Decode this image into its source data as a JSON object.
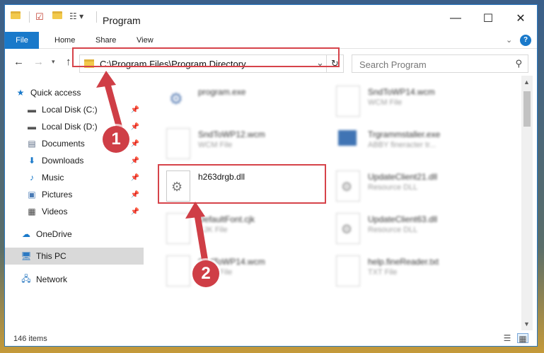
{
  "window": {
    "title": "Program"
  },
  "ribbon": {
    "tabs": [
      "File",
      "Home",
      "Share",
      "View"
    ]
  },
  "address": {
    "path": "C:\\Program Files\\Program Directory"
  },
  "search": {
    "placeholder": "Search Program"
  },
  "sidebar": {
    "items": [
      {
        "label": "Quick access"
      },
      {
        "label": "Local Disk (C:)"
      },
      {
        "label": "Local Disk (D:)"
      },
      {
        "label": "Documents"
      },
      {
        "label": "Downloads"
      },
      {
        "label": "Music"
      },
      {
        "label": "Pictures"
      },
      {
        "label": "Videos"
      },
      {
        "label": "OneDrive"
      },
      {
        "label": "This PC"
      },
      {
        "label": "Network"
      }
    ]
  },
  "files": [
    {
      "name": "program.exe",
      "type": ""
    },
    {
      "name": "SndToWP14.wcm",
      "type": "WCM File"
    },
    {
      "name": "SndToWP12.wcm",
      "type": "WCM File"
    },
    {
      "name": "Trgrammstaller.exe",
      "type": "ABBY fineracter tr..."
    },
    {
      "name": "h263drgb.dll",
      "type": ""
    },
    {
      "name": "UpdateClient21.dll",
      "type": "Resource DLL"
    },
    {
      "name": "DefaultFont.cjk",
      "type": "CJK File"
    },
    {
      "name": "UpdateClient63.dll",
      "type": "Resource DLL"
    },
    {
      "name": "SndToWP14.wcm",
      "type": "WCM File"
    },
    {
      "name": "help.fineReader.txt",
      "type": "TXT File"
    }
  ],
  "status": {
    "item_count": "146 items"
  },
  "steps": {
    "one": "1",
    "two": "2"
  },
  "colors": {
    "accent": "#1979ca",
    "highlight": "#d6434a"
  }
}
